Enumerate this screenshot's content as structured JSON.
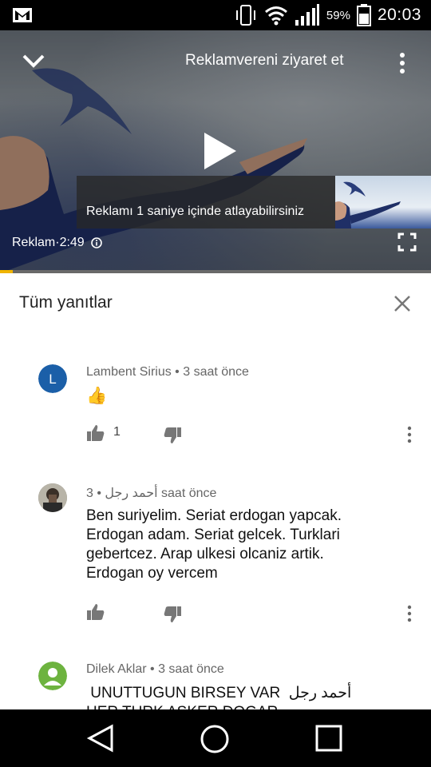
{
  "status_bar": {
    "battery_percent": "59%",
    "time": "20:03"
  },
  "video": {
    "title": "Reklamvereni ziyaret et",
    "skip_text": "Reklamı 1 saniye içinde atlayabilirsiniz",
    "ad_label": "Reklam·2:49",
    "progress_fraction": 0.03,
    "accent_color": "#f2b600"
  },
  "panel": {
    "title": "Tüm yanıtlar"
  },
  "comments": [
    {
      "author": "Lambent Sirius",
      "time": "3 saat önce",
      "avatar_letter": "L",
      "avatar_color": "#1b5fa8",
      "text": "👍",
      "likes": "1"
    },
    {
      "author": "أحمد رجل",
      "time": "3 saat önce",
      "text_lines": [
        "Ben suriyelim. Seriat erdogan yapcak.",
        "Erdogan adam. Seriat gelcek. Turklari",
        "gebertcez. Arap ulkesi olcaniz artik.",
        "Erdogan oy vercem"
      ]
    },
    {
      "author": "Dilek Aklar",
      "time": "3 saat önce",
      "avatar_color": "#6db33f",
      "text_line1": " UNUTTUGUN BIRSEY VAR  أحمد رجل",
      "text_line2": "HER TURK ASKER DOGAR"
    }
  ]
}
